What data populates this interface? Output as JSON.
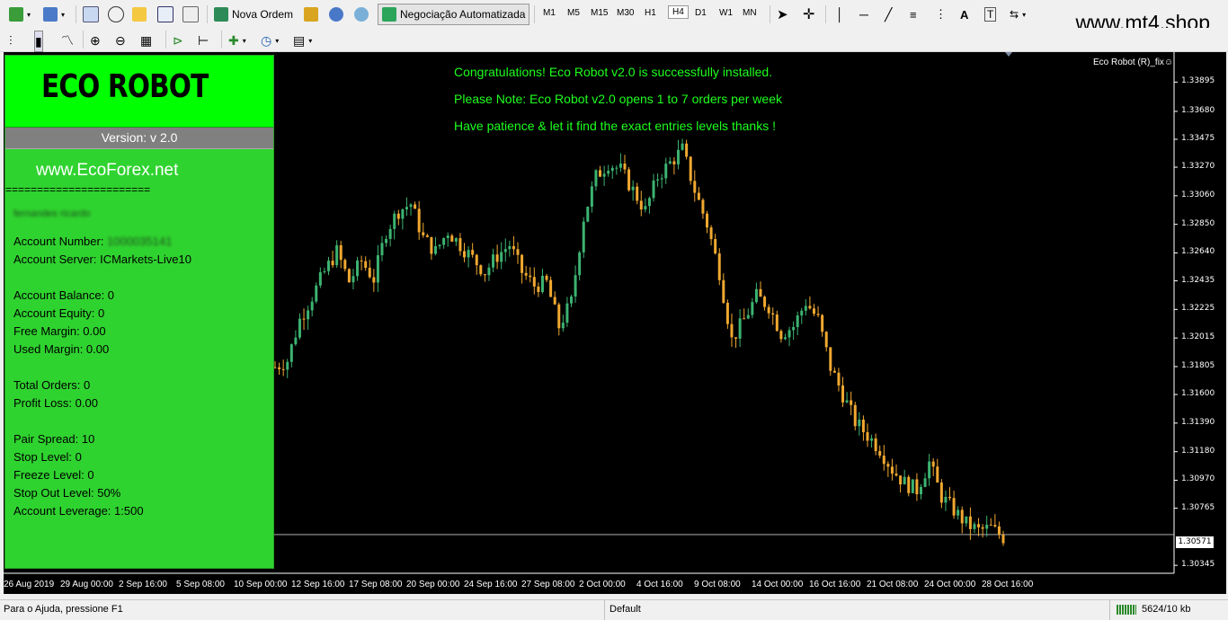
{
  "toolbar": {
    "new_order_label": "Nova Ordem",
    "auto_trading_label": "Negociação Automatizada",
    "timeframes": [
      "M1",
      "M5",
      "M15",
      "M30",
      "H1",
      "H4",
      "D1",
      "W1",
      "MN"
    ],
    "active_timeframe": "H4",
    "site_label": "www.mt4.shop",
    "icons": [
      "new-chart-icon",
      "profiles-icon",
      "properties-icon",
      "crosshair-move-icon",
      "favorites-icon",
      "navigator-icon",
      "zoom-window-icon",
      "gold-icon",
      "people-icon",
      "signals-icon",
      "cursor-icon",
      "crosshair-icon",
      "vertical-line-icon",
      "horizontal-line-icon",
      "trendline-icon",
      "fibonacci-icon",
      "text-icon",
      "text-label-icon",
      "arrows-icon",
      "bar-chart-icon",
      "candlestick-icon",
      "line-chart-icon",
      "zoom-in-icon",
      "zoom-out-icon",
      "tile-icon",
      "autoscroll-icon",
      "chart-shift-icon",
      "indicators-icon",
      "periods-icon",
      "templates-icon"
    ]
  },
  "panel": {
    "title": "ECO ROBOT",
    "version": "Version: v 2.0",
    "site": "www.EcoForex.net",
    "rule": "=======================",
    "account_name": "fernandes ricardo",
    "account_number_label": "Account Number:",
    "account_number_value": "1000035141",
    "account_server": "Account Server: ICMarkets-Live10",
    "account_balance": "Account Balance: 0",
    "account_equity": "Account Equity: 0",
    "free_margin": "Free Margin: 0.00",
    "used_margin": "Used Margin: 0.00",
    "total_orders": "Total Orders: 0",
    "profit_loss": "Profit Loss: 0.00",
    "pair_spread": "Pair Spread: 10",
    "stop_level": "Stop Level: 0",
    "freeze_level": "Freeze Level: 0",
    "stop_out_level": "Stop Out Level: 50%",
    "account_leverage": "Account Leverage: 1:500"
  },
  "messages": {
    "line1": "Congratulations! Eco Robot v2.0 is successfully installed.",
    "line2": "Please Note: Eco Robot v2.0 opens 1 to 7 orders per week",
    "line3": "Have patience & let it find the exact entries levels thanks !"
  },
  "indicator_label": "Eco Robot (R)_fix☺",
  "chart_data": {
    "type": "candlestick",
    "price_labels": [
      "1.33895",
      "1.33680",
      "1.33475",
      "1.33270",
      "1.33060",
      "1.32850",
      "1.32640",
      "1.32435",
      "1.32225",
      "1.32015",
      "1.31805",
      "1.31600",
      "1.31390",
      "1.31180",
      "1.30970",
      "1.30765",
      "1.30345"
    ],
    "current_price": "1.30571",
    "time_labels": [
      "26 Aug 2019",
      "29 Aug 00:00",
      "2 Sep 16:00",
      "5 Sep 08:00",
      "10 Sep 00:00",
      "12 Sep 16:00",
      "17 Sep 08:00",
      "20 Sep 00:00",
      "24 Sep 16:00",
      "27 Sep 08:00",
      "2 Oct 00:00",
      "4 Oct 16:00",
      "9 Oct 08:00",
      "14 Oct 00:00",
      "16 Oct 16:00",
      "21 Oct 08:00",
      "24 Oct 00:00",
      "28 Oct 16:00"
    ],
    "ylim": [
      1.3028,
      1.3397
    ],
    "bull_color": "#3cb371",
    "bear_color": "#f0a830",
    "close_path": [
      1.318,
      1.3185,
      1.3215,
      1.3232,
      1.325,
      1.3265,
      1.3243,
      1.3258,
      1.3245,
      1.328,
      1.3295,
      1.33,
      1.3275,
      1.3265,
      1.328,
      1.327,
      1.326,
      1.325,
      1.3262,
      1.327,
      1.325,
      1.324,
      1.3242,
      1.321,
      1.3228,
      1.329,
      1.332,
      1.333,
      1.3325,
      1.331,
      1.3295,
      1.332,
      1.333,
      1.334,
      1.331,
      1.3285,
      1.325,
      1.32,
      1.3215,
      1.3232,
      1.3225,
      1.3205,
      1.321,
      1.3228,
      1.3215,
      1.318,
      1.316,
      1.314,
      1.313,
      1.312,
      1.3105,
      1.3095,
      1.309,
      1.311,
      1.3085,
      1.3075,
      1.3065,
      1.306,
      1.3062,
      1.3055
    ],
    "candles_per_step": 3
  },
  "status": {
    "help": "Para o Ajuda, pressione F1",
    "profile": "Default",
    "traffic": "5624/10 kb"
  }
}
